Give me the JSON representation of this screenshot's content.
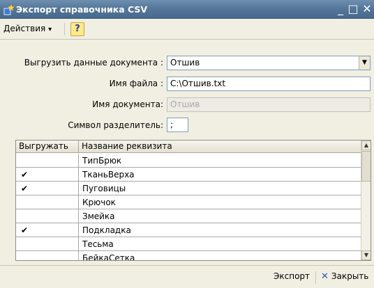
{
  "window": {
    "title": "Экспорт справочника CSV",
    "minimize_glyph": "_",
    "maximize_glyph": "□",
    "close_glyph": "✕"
  },
  "toolbar": {
    "actions_label": "Действия",
    "actions_arrow": "▾",
    "help_label": "?"
  },
  "form": {
    "export_doc_label": "Выгрузить данные документа :",
    "export_doc_value": "Отшив",
    "filename_label": "Имя файла :",
    "filename_value": "C:\\Отшив.txt",
    "docname_label": "Имя документа:",
    "docname_value": "Отшив",
    "separator_label": "Символ разделитель:",
    "separator_value": ";"
  },
  "table": {
    "columns": [
      "Выгружать",
      "Название реквизита"
    ],
    "rows": [
      {
        "check": "",
        "name": "ТипБрюк"
      },
      {
        "check": "✔",
        "name": "ТканьВерха"
      },
      {
        "check": "✔",
        "name": "Пуговицы"
      },
      {
        "check": "",
        "name": "Крючок"
      },
      {
        "check": "",
        "name": "Змейка"
      },
      {
        "check": "✔",
        "name": "Подкладка"
      },
      {
        "check": "",
        "name": "Тесьма"
      },
      {
        "check": "",
        "name": "БейкаСетка"
      }
    ]
  },
  "footer": {
    "export_label": "Экспорт",
    "close_label": "Закрыть",
    "close_glyph": "✕"
  },
  "colors": {
    "titlebar": "#55779a",
    "window_bg": "#f1efe2",
    "help_bg": "#fde98c",
    "close_icon": "#1c56c6"
  }
}
